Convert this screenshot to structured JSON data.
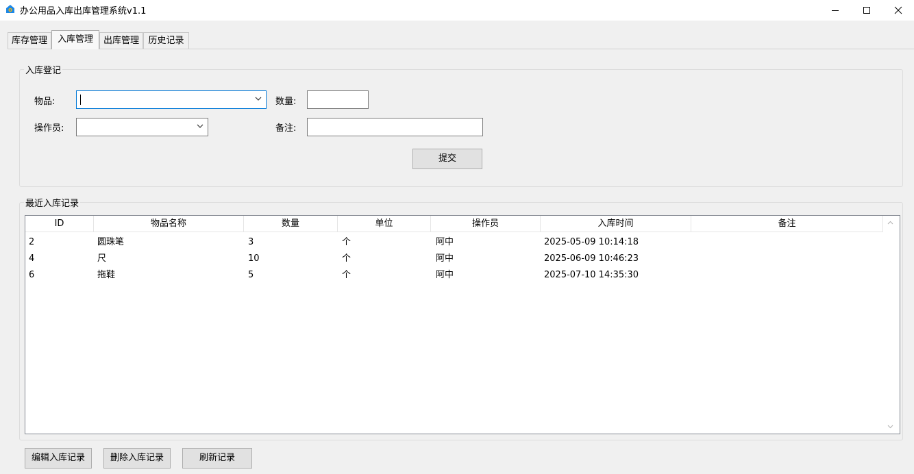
{
  "window": {
    "title": "办公用品入库出库管理系统v1.1",
    "icon": "house-app-icon",
    "controls": [
      "minimize",
      "maximize",
      "close"
    ]
  },
  "tabs": [
    {
      "label": "库存管理",
      "active": false
    },
    {
      "label": "入库管理",
      "active": true
    },
    {
      "label": "出库管理",
      "active": false
    },
    {
      "label": "历史记录",
      "active": false
    }
  ],
  "form": {
    "group_title": "入库登记",
    "item_label": "物品:",
    "item_value": "",
    "quantity_label": "数量:",
    "quantity_value": "",
    "operator_label": "操作员:",
    "operator_value": "",
    "remark_label": "备注:",
    "remark_value": "",
    "submit_label": "提交"
  },
  "records": {
    "group_title": "最近入库记录",
    "columns": [
      "ID",
      "物品名称",
      "数量",
      "单位",
      "操作员",
      "入库时间",
      "备注"
    ],
    "rows": [
      [
        "2",
        "圆珠笔",
        "3",
        "个",
        "阿中",
        "2025-05-09 10:14:18",
        ""
      ],
      [
        "4",
        "尺",
        "10",
        "个",
        "阿中",
        "2025-06-09 10:46:23",
        ""
      ],
      [
        "6",
        "拖鞋",
        "5",
        "个",
        "阿中",
        "2025-07-10 14:35:30",
        ""
      ]
    ]
  },
  "actions": {
    "edit_label": "编辑入库记录",
    "delete_label": "删除入库记录",
    "refresh_label": "刷新记录"
  },
  "colors": {
    "accent": "#0078d7",
    "app_icon": "#1e88e5",
    "app_icon_badge": "#ffb300"
  }
}
